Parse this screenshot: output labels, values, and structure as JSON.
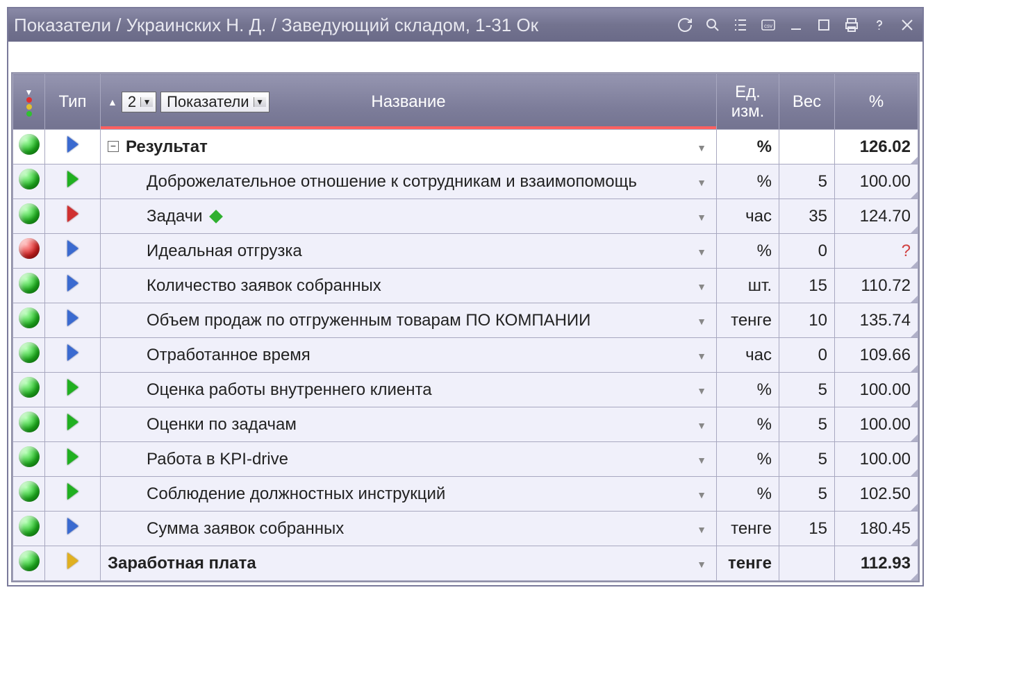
{
  "title": "Показатели / Украинских Н. Д. / Заведующий складом, 1-31 Ок",
  "header": {
    "type": "Тип",
    "name": "Название",
    "unit": "Ед.\nизм.",
    "weight": "Вес",
    "pct": "%",
    "level_value": "2",
    "group_value": "Показатели"
  },
  "rows": [
    {
      "status": "green",
      "type": "blue",
      "collapse": true,
      "indent": false,
      "bold": true,
      "name": "Результат",
      "badge": false,
      "unit": "%",
      "weight": "",
      "pct": "126.02"
    },
    {
      "status": "green",
      "type": "green",
      "collapse": false,
      "indent": true,
      "bold": false,
      "name": "Доброжелательное отношение к сотрудникам и взаимопомощь",
      "badge": false,
      "unit": "%",
      "weight": "5",
      "pct": "100.00"
    },
    {
      "status": "green",
      "type": "red",
      "collapse": false,
      "indent": true,
      "bold": false,
      "name": "Задачи",
      "badge": true,
      "unit": "час",
      "weight": "35",
      "pct": "124.70"
    },
    {
      "status": "red",
      "type": "blue",
      "collapse": false,
      "indent": true,
      "bold": false,
      "name": "Идеальная отгрузка",
      "badge": false,
      "unit": "%",
      "weight": "0",
      "pct": "?"
    },
    {
      "status": "green",
      "type": "blue",
      "collapse": false,
      "indent": true,
      "bold": false,
      "name": "Количество заявок собранных",
      "badge": false,
      "unit": "шт.",
      "weight": "15",
      "pct": "110.72"
    },
    {
      "status": "green",
      "type": "blue",
      "collapse": false,
      "indent": true,
      "bold": false,
      "name": "Объем продаж по отгруженным товарам ПО КОМПАНИИ",
      "badge": false,
      "unit": "тенге",
      "weight": "10",
      "pct": "135.74"
    },
    {
      "status": "green",
      "type": "blue",
      "collapse": false,
      "indent": true,
      "bold": false,
      "name": "Отработанное время",
      "badge": false,
      "unit": "час",
      "weight": "0",
      "pct": "109.66"
    },
    {
      "status": "green",
      "type": "green",
      "collapse": false,
      "indent": true,
      "bold": false,
      "name": "Оценка работы внутреннего клиента",
      "badge": false,
      "unit": "%",
      "weight": "5",
      "pct": "100.00"
    },
    {
      "status": "green",
      "type": "green",
      "collapse": false,
      "indent": true,
      "bold": false,
      "name": "Оценки по задачам",
      "badge": false,
      "unit": "%",
      "weight": "5",
      "pct": "100.00"
    },
    {
      "status": "green",
      "type": "green",
      "collapse": false,
      "indent": true,
      "bold": false,
      "name": "Работа в KPI-drive",
      "badge": false,
      "unit": "%",
      "weight": "5",
      "pct": "100.00"
    },
    {
      "status": "green",
      "type": "green",
      "collapse": false,
      "indent": true,
      "bold": false,
      "name": "Соблюдение должностных инструкций",
      "badge": false,
      "unit": "%",
      "weight": "5",
      "pct": "102.50"
    },
    {
      "status": "green",
      "type": "blue",
      "collapse": false,
      "indent": true,
      "bold": false,
      "name": "Сумма заявок собранных",
      "badge": false,
      "unit": "тенге",
      "weight": "15",
      "pct": "180.45"
    },
    {
      "status": "green",
      "type": "yellow",
      "collapse": false,
      "indent": false,
      "bold": true,
      "name": "Заработная плата",
      "badge": false,
      "unit": "тенге",
      "weight": "",
      "pct": "112.93"
    }
  ]
}
